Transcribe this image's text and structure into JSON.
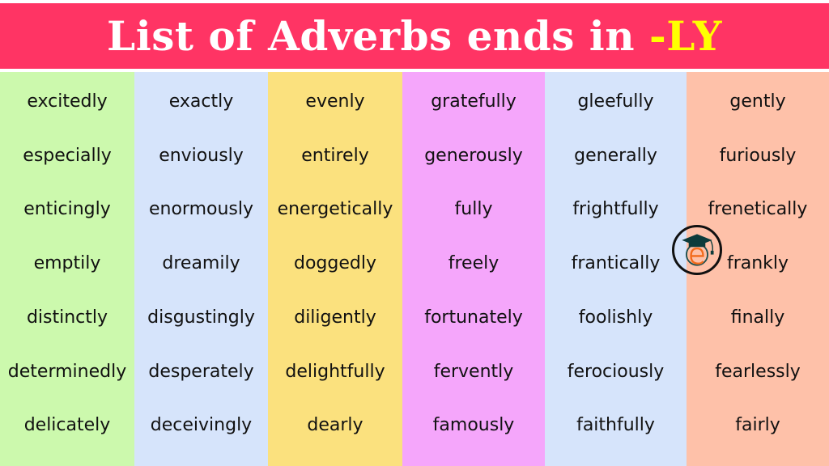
{
  "header": {
    "title_main": "List of Adverbs ends in ",
    "title_highlight": "-LY",
    "colors": {
      "background": "#ff3464",
      "text": "#ffffff",
      "highlight": "#ffff00"
    }
  },
  "columns": [
    {
      "color": "#ccf9ad",
      "words": [
        "excitedly",
        "especially",
        "enticingly",
        "emptily",
        "distinctly",
        "determinedly",
        "delicately"
      ]
    },
    {
      "color": "#d6e4fb",
      "words": [
        "exactly",
        "enviously",
        "enormously",
        "dreamily",
        "disgustingly",
        "desperately",
        "deceivingly"
      ]
    },
    {
      "color": "#fbe17e",
      "words": [
        "evenly",
        "entirely",
        "energetically",
        "doggedly",
        "diligently",
        "delightfully",
        "dearly"
      ]
    },
    {
      "color": "#f5a6fb",
      "words": [
        "gratefully",
        "generously",
        "fully",
        "freely",
        "fortunately",
        "fervently",
        "famously"
      ]
    },
    {
      "color": "#d6e4fb",
      "words": [
        "gleefully",
        "generally",
        "frightfully",
        "frantically",
        "foolishly",
        "ferociously",
        "faithfully"
      ]
    },
    {
      "color": "#fec1a9",
      "words": [
        "gently",
        "furiously",
        "frenetically",
        "frankly",
        "finally",
        "fearlessly",
        "fairly"
      ]
    }
  ],
  "logo": {
    "icon": "graduation-cap-e-logo"
  }
}
